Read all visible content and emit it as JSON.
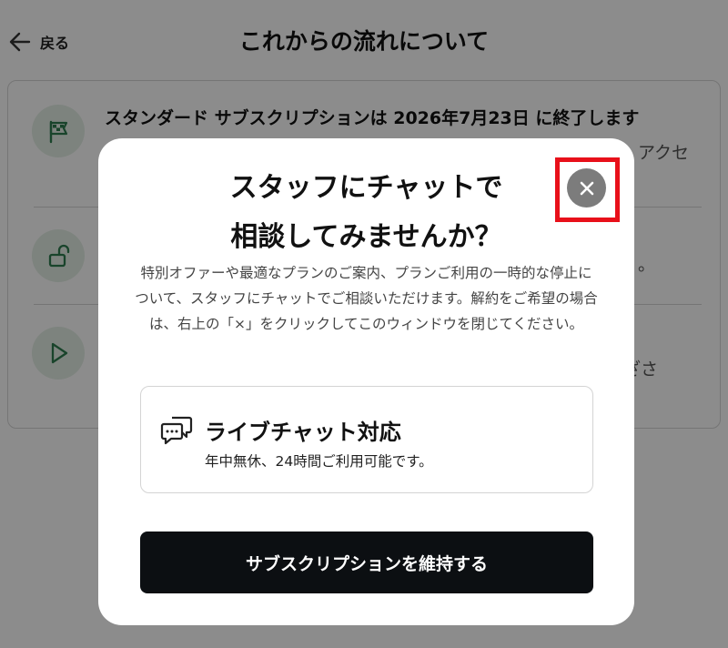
{
  "header": {
    "back_label": "戻る",
    "title": "これからの流れについて"
  },
  "steps": [
    {
      "icon": "flag-icon",
      "title": "スタンダード サブスクリプションは 2026年7月23日 に終了します",
      "text_fragment": "アクセ"
    },
    {
      "icon": "unlock-icon",
      "text_fragment": "。"
    },
    {
      "icon": "play-icon",
      "text_fragment": "ざさ"
    }
  ],
  "modal": {
    "title_line1": "スタッフにチャットで",
    "title_line2": "相談してみませんか？",
    "description": "特別オファーや最適なプランのご案内、プランご利用の一時的な停止について、スタッフにチャットでご相談いただけます。解約をご希望の場合は、右上の「×」をクリックしてこのウィンドウを閉じてください。",
    "feature": {
      "icon": "chat-bubbles-icon",
      "title": "ライブチャット対応",
      "text": "年中無休、24時間ご利用可能です。"
    },
    "primary_button": "サブスクリプションを維持する",
    "close_icon": "close-icon"
  },
  "colors": {
    "overlay": "rgba(0,0,0,0.45)",
    "accent_green": "#2e7d4f",
    "icon_bg": "#e4efe6",
    "button_bg": "#0c0f12",
    "close_bg": "#7c7c7c",
    "highlight_red": "#e8101a"
  }
}
